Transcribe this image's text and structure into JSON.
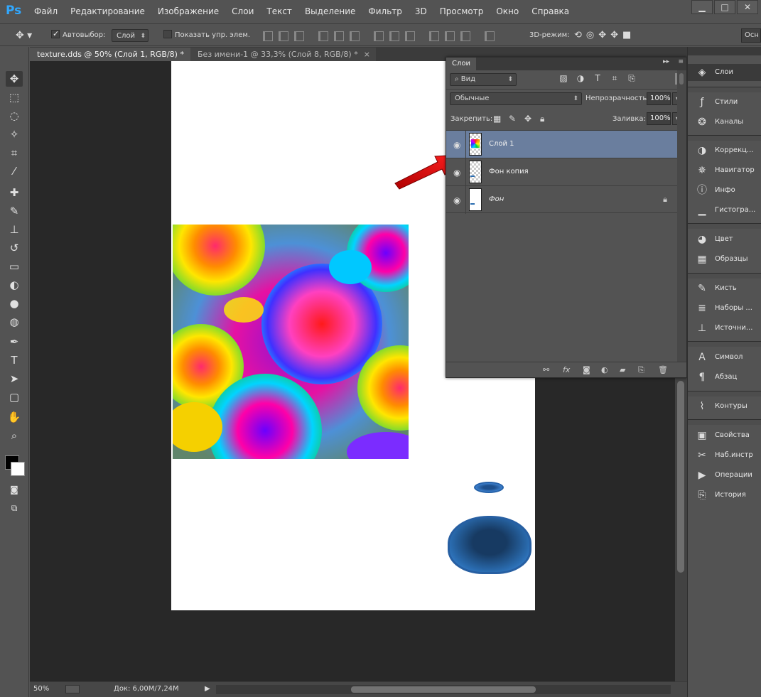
{
  "app": {
    "logo": "Ps"
  },
  "menu": [
    "Файл",
    "Редактирование",
    "Изображение",
    "Слои",
    "Текст",
    "Выделение",
    "Фильтр",
    "3D",
    "Просмотр",
    "Окно",
    "Справка"
  ],
  "window_controls": {
    "minimize": "▁",
    "maximize": "□",
    "close": "✕"
  },
  "options": {
    "autoselect_label": "Автовыбор:",
    "autoselect_checked": true,
    "autoselect_value": "Слой",
    "show_transform_label": "Показать упр. элем.",
    "show_transform_checked": false,
    "mode3d_label": "3D-режим:",
    "workspace_button": "Осн"
  },
  "tabs": [
    {
      "label": "texture.dds @ 50% (Слой 1, RGB/8) *",
      "close": "×",
      "active": true
    },
    {
      "label": "Без имени-1 @ 33,3% (Слой 8, RGB/8) *",
      "close": "×",
      "active": false
    }
  ],
  "tools": [
    {
      "name": "move-tool-icon",
      "glyph": "✥"
    },
    {
      "name": "marquee-tool-icon",
      "glyph": "⬚"
    },
    {
      "name": "lasso-tool-icon",
      "glyph": "◌"
    },
    {
      "name": "quick-select-tool-icon",
      "glyph": "✧"
    },
    {
      "name": "crop-tool-icon",
      "glyph": "⌗"
    },
    {
      "name": "eyedropper-tool-icon",
      "glyph": "⁄"
    },
    {
      "name": "healing-brush-tool-icon",
      "glyph": "✚"
    },
    {
      "name": "brush-tool-icon",
      "glyph": "✎"
    },
    {
      "name": "stamp-tool-icon",
      "glyph": "⊥"
    },
    {
      "name": "history-brush-tool-icon",
      "glyph": "↺"
    },
    {
      "name": "eraser-tool-icon",
      "glyph": "▭"
    },
    {
      "name": "paint-bucket-tool-icon",
      "glyph": "◐"
    },
    {
      "name": "blur-tool-icon",
      "glyph": "●"
    },
    {
      "name": "dodge-tool-icon",
      "glyph": "◍"
    },
    {
      "name": "pen-tool-icon",
      "glyph": "✒"
    },
    {
      "name": "type-tool-icon",
      "glyph": "T"
    },
    {
      "name": "path-select-tool-icon",
      "glyph": "➤"
    },
    {
      "name": "shape-tool-icon",
      "glyph": "▢"
    },
    {
      "name": "hand-tool-icon",
      "glyph": "✋"
    },
    {
      "name": "zoom-tool-icon",
      "glyph": "⌕"
    }
  ],
  "colors": {
    "foreground": "#000000",
    "background": "#ffffff",
    "selection": "#6a7e9e",
    "arrow": "#e00000"
  },
  "layers_panel": {
    "tab": "Слои",
    "filter_kind": "Вид",
    "blend_mode": "Обычные",
    "opacity_label": "Непрозрачность:",
    "opacity_value": "100%",
    "lock_label": "Закрепить:",
    "fill_label": "Заливка:",
    "fill_value": "100%",
    "layers": [
      {
        "name": "Слой 1",
        "selected": true,
        "locked": false,
        "italic": false
      },
      {
        "name": "Фон копия",
        "selected": false,
        "locked": false,
        "italic": false
      },
      {
        "name": "Фон",
        "selected": false,
        "locked": true,
        "italic": true
      }
    ]
  },
  "dock": [
    {
      "label": "Слои",
      "icon": "layers-icon",
      "glyph": "◈",
      "active": true
    },
    {
      "label": "Стили",
      "icon": "styles-icon",
      "glyph": "ƒ"
    },
    {
      "label": "Каналы",
      "icon": "channels-icon",
      "glyph": "❂"
    },
    {
      "label": "Коррекц...",
      "icon": "adjustments-icon",
      "glyph": "◑"
    },
    {
      "label": "Навигатор",
      "icon": "navigator-icon",
      "glyph": "✵"
    },
    {
      "label": "Инфо",
      "icon": "info-icon",
      "glyph": "ⓘ"
    },
    {
      "label": "Гистогра...",
      "icon": "histogram-icon",
      "glyph": "▁"
    },
    {
      "label": "Цвет",
      "icon": "color-icon",
      "glyph": "◕"
    },
    {
      "label": "Образцы",
      "icon": "swatches-icon",
      "glyph": "▦"
    },
    {
      "label": "Кисть",
      "icon": "brush-icon",
      "glyph": "✎"
    },
    {
      "label": "Наборы ...",
      "icon": "brush-presets-icon",
      "glyph": "≣"
    },
    {
      "label": "Источни...",
      "icon": "clone-source-icon",
      "glyph": "⊥"
    },
    {
      "label": "Символ",
      "icon": "character-icon",
      "glyph": "A"
    },
    {
      "label": "Абзац",
      "icon": "paragraph-icon",
      "glyph": "¶"
    },
    {
      "label": "Контуры",
      "icon": "paths-icon",
      "glyph": "⌇"
    },
    {
      "label": "Свойства",
      "icon": "properties-icon",
      "glyph": "▣"
    },
    {
      "label": "Наб.инстр",
      "icon": "tool-presets-icon",
      "glyph": "✂"
    },
    {
      "label": "Операции",
      "icon": "actions-icon",
      "glyph": "▶"
    },
    {
      "label": "История",
      "icon": "history-icon",
      "glyph": "⎘"
    }
  ],
  "status": {
    "zoom": "50%",
    "doc_info": "Док: 6,00M/7,24M"
  }
}
